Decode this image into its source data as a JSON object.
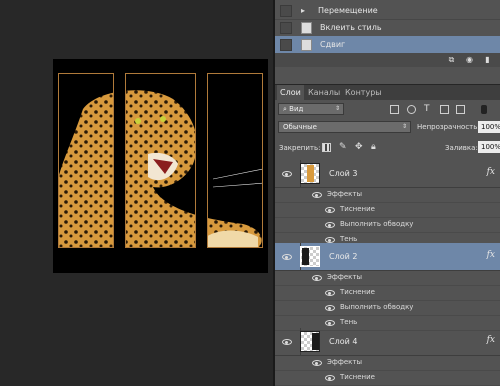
{
  "history": {
    "items": [
      {
        "label": "Перемещение",
        "selected": false
      },
      {
        "label": "Вклеить стиль",
        "selected": false
      },
      {
        "label": "Сдвиг",
        "selected": true
      }
    ]
  },
  "panels": {
    "tabs": [
      "Слои",
      "Каналы",
      "Контуры"
    ],
    "active_tab": "Слои"
  },
  "layers_toolbar": {
    "filter_select": "Вид",
    "blend_mode": "Обычные",
    "opacity_label": "Непрозрачность:",
    "opacity_value": "100%",
    "lock_label": "Закрепить:",
    "fill_label": "Заливка:",
    "fill_value": "100%"
  },
  "layers": [
    {
      "name": "Слой 3",
      "selected": false,
      "fx": "fx",
      "effects_label": "Эффекты",
      "effects": [
        "Тиснение",
        "Выполнить обводку",
        "Тень"
      ]
    },
    {
      "name": "Слой 2",
      "selected": true,
      "fx": "fx",
      "effects_label": "Эффекты",
      "effects": [
        "Тиснение",
        "Выполнить обводку",
        "Тень"
      ]
    },
    {
      "name": "Слой 4",
      "selected": false,
      "fx": "fx",
      "effects_label": "Эффекты",
      "effects": [
        "Тиснение"
      ]
    }
  ],
  "colors": {
    "workspace_bg": "#282828",
    "panel_bg": "#535353",
    "selection": "#6e87a8",
    "frame_stroke": "#b07a3a"
  },
  "icons": {
    "filter": "search-icon",
    "lock_transparent": "checkerboard-lock-icon",
    "lock_pixels": "brush-icon",
    "lock_position": "move-icon",
    "lock_all": "padlock-icon",
    "visibility": "eye-icon",
    "effects": "fx-icon"
  }
}
